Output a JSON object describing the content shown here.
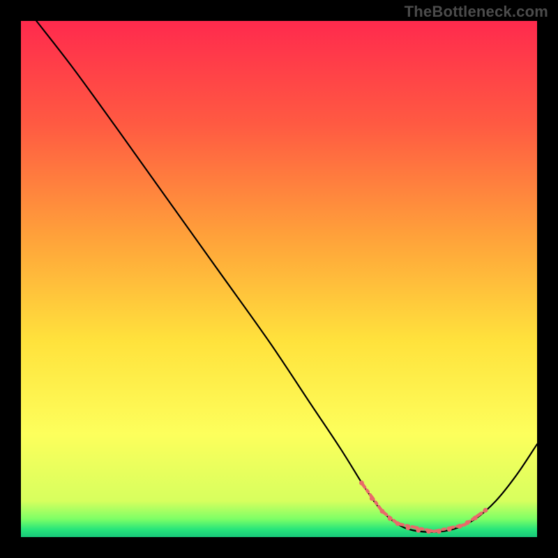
{
  "watermark": "TheBottleneck.com",
  "chart_data": {
    "type": "line",
    "title": "",
    "xlabel": "",
    "ylabel": "",
    "xlim": [
      0,
      100
    ],
    "ylim": [
      0,
      100
    ],
    "grid": false,
    "legend": false,
    "gradient_stops": [
      {
        "offset": 0.0,
        "color": "#ff2a4d"
      },
      {
        "offset": 0.2,
        "color": "#ff5a42"
      },
      {
        "offset": 0.42,
        "color": "#ffa23a"
      },
      {
        "offset": 0.62,
        "color": "#ffe23c"
      },
      {
        "offset": 0.8,
        "color": "#fdff5c"
      },
      {
        "offset": 0.93,
        "color": "#d7ff5e"
      },
      {
        "offset": 0.965,
        "color": "#7dff66"
      },
      {
        "offset": 0.985,
        "color": "#28e57a"
      },
      {
        "offset": 1.0,
        "color": "#18c87a"
      }
    ],
    "series": [
      {
        "name": "curve",
        "stroke": "#000000",
        "stroke_width": 2.2,
        "points": [
          {
            "x": 3,
            "y": 100
          },
          {
            "x": 10,
            "y": 91
          },
          {
            "x": 18,
            "y": 80
          },
          {
            "x": 28,
            "y": 66
          },
          {
            "x": 38,
            "y": 52
          },
          {
            "x": 48,
            "y": 38
          },
          {
            "x": 56,
            "y": 26
          },
          {
            "x": 62,
            "y": 17
          },
          {
            "x": 67,
            "y": 9
          },
          {
            "x": 70,
            "y": 5
          },
          {
            "x": 73,
            "y": 2.5
          },
          {
            "x": 76,
            "y": 1.3
          },
          {
            "x": 80,
            "y": 1.0
          },
          {
            "x": 84,
            "y": 1.6
          },
          {
            "x": 88,
            "y": 3.5
          },
          {
            "x": 92,
            "y": 7
          },
          {
            "x": 96,
            "y": 12
          },
          {
            "x": 100,
            "y": 18
          }
        ]
      }
    ],
    "highlight_band": {
      "color": "#e86a6a",
      "dot_radius": 3.4,
      "dash": [
        8,
        5,
        3,
        5
      ],
      "x_start": 66,
      "x_end": 90,
      "segments": [
        {
          "x1": 66,
          "y1": 10.5,
          "x2": 70,
          "y2": 5.0
        },
        {
          "x1": 70,
          "y1": 5.0,
          "x2": 73,
          "y2": 2.6
        },
        {
          "x1": 73,
          "y1": 2.6,
          "x2": 80,
          "y2": 1.1
        },
        {
          "x1": 80,
          "y1": 1.1,
          "x2": 86,
          "y2": 2.4
        },
        {
          "x1": 86,
          "y1": 2.4,
          "x2": 90,
          "y2": 5.2
        }
      ],
      "dots": [
        {
          "x": 66,
          "y": 10.5
        },
        {
          "x": 68,
          "y": 7.5
        },
        {
          "x": 70,
          "y": 5.0
        },
        {
          "x": 71.5,
          "y": 3.6
        },
        {
          "x": 73,
          "y": 2.6
        },
        {
          "x": 75,
          "y": 1.8
        },
        {
          "x": 77,
          "y": 1.3
        },
        {
          "x": 79,
          "y": 1.1
        },
        {
          "x": 81,
          "y": 1.1
        },
        {
          "x": 83,
          "y": 1.5
        },
        {
          "x": 85,
          "y": 2.1
        },
        {
          "x": 86.5,
          "y": 2.8
        },
        {
          "x": 88,
          "y": 3.7
        },
        {
          "x": 90,
          "y": 5.2
        }
      ]
    }
  }
}
